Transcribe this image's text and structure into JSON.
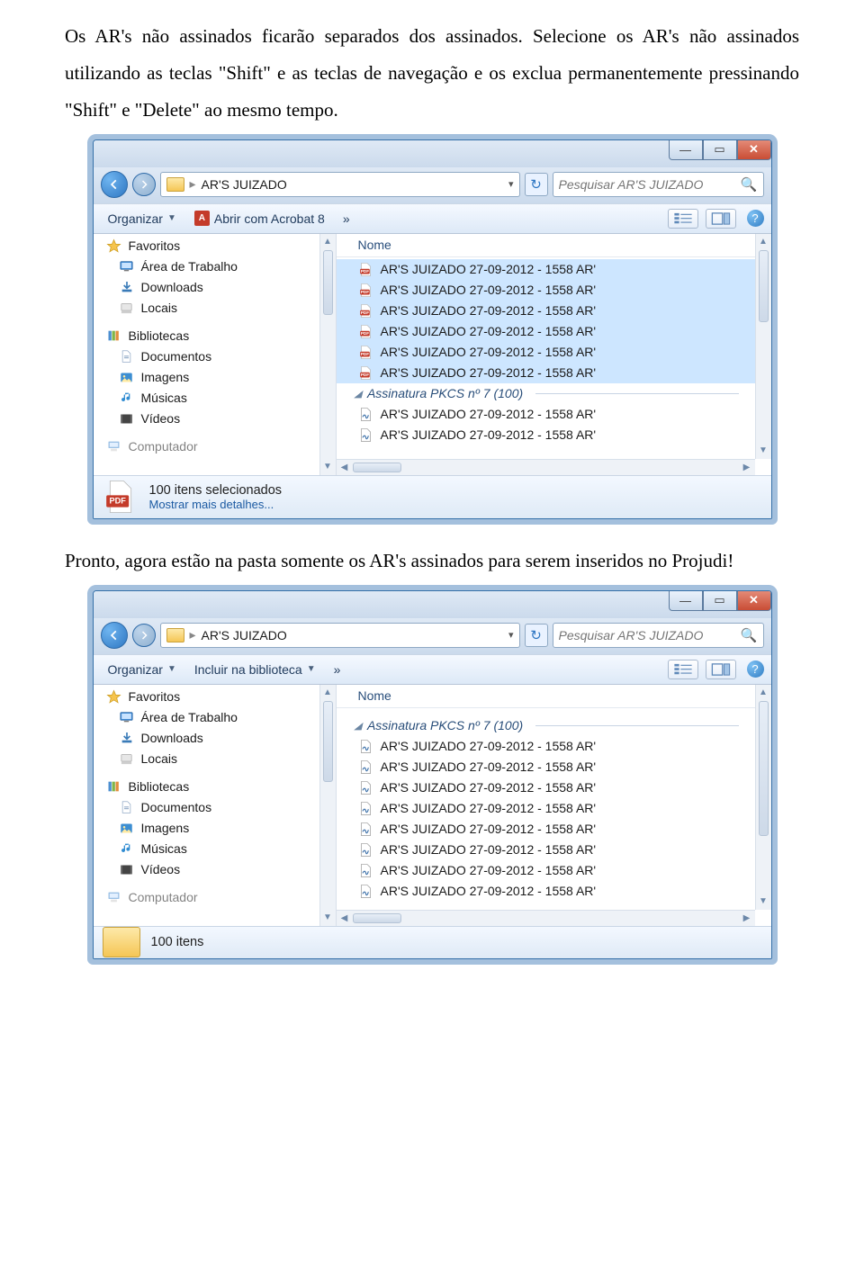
{
  "paragraphs": {
    "p1": "Os AR's não assinados ficarão separados dos assinados. Selecione os AR's não assinados utilizando as teclas \"Shift\" e as teclas de navegação e os exclua permanentemente pressinando \"Shift\" e \"Delete\" ao mesmo tempo.",
    "p2": "Pronto, agora estão na pasta somente os AR's assinados para serem inseridos no Projudi!"
  },
  "explorer": {
    "breadcrumb": {
      "folder": "AR'S JUIZADO"
    },
    "search_placeholder": "Pesquisar AR'S JUIZADO",
    "toolbar": {
      "organizar": "Organizar",
      "abrir_acrobat": "Abrir com Acrobat 8",
      "incluir_biblioteca": "Incluir na biblioteca",
      "more": "»"
    },
    "column_header": "Nome",
    "sidebar": {
      "favoritos": "Favoritos",
      "area_trabalho": "Área de Trabalho",
      "downloads": "Downloads",
      "locais": "Locais",
      "bibliotecas": "Bibliotecas",
      "documentos": "Documentos",
      "imagens": "Imagens",
      "musicas": "Músicas",
      "videos": "Vídeos",
      "computador": "Computador"
    },
    "window1": {
      "pdf_rows": [
        "AR'S JUIZADO 27-09-2012 - 1558 AR'",
        "AR'S JUIZADO 27-09-2012 - 1558 AR'",
        "AR'S JUIZADO 27-09-2012 - 1558 AR'",
        "AR'S JUIZADO 27-09-2012 - 1558 AR'",
        "AR'S JUIZADO 27-09-2012 - 1558 AR'",
        "AR'S JUIZADO 27-09-2012 - 1558 AR'"
      ],
      "group": "Assinatura PKCS nº 7 (100)",
      "sig_rows": [
        "AR'S JUIZADO 27-09-2012 - 1558 AR'",
        "AR'S JUIZADO 27-09-2012 - 1558 AR'"
      ],
      "status_line1": "100 itens selecionados",
      "status_line2": "Mostrar mais detalhes..."
    },
    "window2": {
      "group": "Assinatura PKCS nº 7 (100)",
      "sig_rows": [
        "AR'S JUIZADO 27-09-2012 - 1558 AR'",
        "AR'S JUIZADO 27-09-2012 - 1558 AR'",
        "AR'S JUIZADO 27-09-2012 - 1558 AR'",
        "AR'S JUIZADO 27-09-2012 - 1558 AR'",
        "AR'S JUIZADO 27-09-2012 - 1558 AR'",
        "AR'S JUIZADO 27-09-2012 - 1558 AR'",
        "AR'S JUIZADO 27-09-2012 - 1558 AR'",
        "AR'S JUIZADO 27-09-2012 - 1558 AR'"
      ],
      "status_line1": "100 itens"
    }
  }
}
